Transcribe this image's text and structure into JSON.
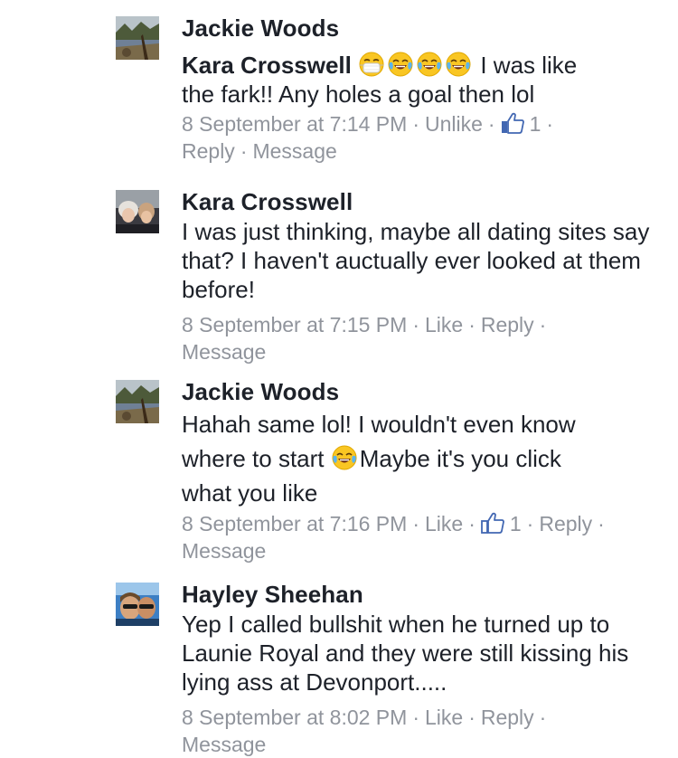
{
  "colors": {
    "text": "#1d2129",
    "meta": "#90949c",
    "like_blue": "#4267b2"
  },
  "comments": [
    {
      "author": "Jackie Woods",
      "mention": "Kara Crosswell",
      "emojis": [
        "face-with-medical-mask-emoji",
        "tears-of-joy-emoji",
        "tears-of-joy-emoji",
        "tears-of-joy-emoji"
      ],
      "text_line1": "I was like",
      "text_rest": "the fark!! Any holes a goal then lol",
      "timestamp": "8 September at 7:14 PM",
      "like_action": "Unlike",
      "like_count": "1",
      "reply": "Reply",
      "message": "Message"
    },
    {
      "author": "Kara Crosswell",
      "text": "I was just thinking, maybe all dating sites say that? I haven't auctually ever looked at them before!",
      "timestamp": "8 September at 7:15 PM",
      "like_action": "Like",
      "reply": "Reply",
      "message": "Message"
    },
    {
      "author": "Jackie Woods",
      "text_line1": "Hahah same lol! I wouldn't even know",
      "text_line2_pre": "where to start",
      "emoji": "tears-of-joy-emoji",
      "text_line2_post": "Maybe it's you click",
      "text_line3": "what you like",
      "timestamp": "8 September at 7:16 PM",
      "like_action": "Like",
      "like_count": "1",
      "reply": "Reply",
      "message": "Message"
    },
    {
      "author": "Hayley Sheehan",
      "text": "Yep I called bullshit when he turned up to Launie Royal and they were still kissing his lying ass at Devonport.....",
      "timestamp": "8 September at 8:02 PM",
      "like_action": "Like",
      "reply": "Reply",
      "message": "Message"
    }
  ]
}
